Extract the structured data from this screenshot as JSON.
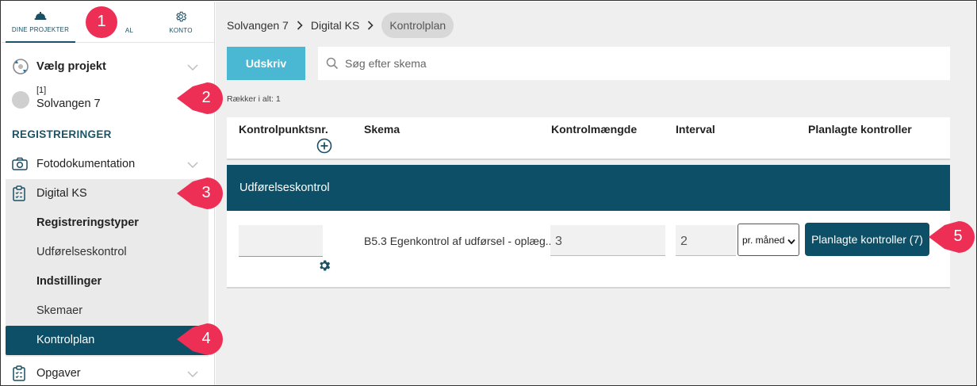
{
  "topnav": {
    "projects_label": "DINE PROJEKTER",
    "middle_label": "AL",
    "account_label": "KONTO"
  },
  "sidebar": {
    "choose_project": "Vælg projekt",
    "project": {
      "number": "[1]",
      "name": "Solvangen 7"
    },
    "section_title": "REGISTRERINGER",
    "items": [
      {
        "label": "Fotodokumentation",
        "icon": "camera-icon"
      },
      {
        "label": "Digital KS",
        "icon": "clipboard-icon"
      }
    ],
    "digital_ks_sub": [
      {
        "label": "Registreringstyper",
        "bold": true
      },
      {
        "label": "Udførelseskontrol",
        "bold": false
      },
      {
        "label": "Indstillinger",
        "bold": true
      },
      {
        "label": "Skemaer",
        "bold": false
      },
      {
        "label": "Kontrolplan",
        "active": true
      }
    ],
    "last_item": {
      "label": "Opgaver",
      "icon": "clipboard-icon"
    }
  },
  "breadcrumb": [
    "Solvangen 7",
    "Digital KS",
    "Kontrolplan"
  ],
  "toolbar": {
    "print_label": "Udskriv",
    "search_placeholder": "Søg efter skema"
  },
  "row_count": "Rækker i alt: 1",
  "table": {
    "columns": [
      "Kontrolpunktsnr.",
      "Skema",
      "Kontrolmængde",
      "Interval",
      "Planlagte kontroller"
    ],
    "group_title": "Udførelseskontrol",
    "rows": [
      {
        "kontrolpunkt": "",
        "skema": "B5.3 Egenkontrol af udførsel - oplæg...",
        "kontrolmaengde": "3",
        "interval": "2",
        "interval_unit": "pr. måned",
        "planned_button": "Planlagte kontroller (7)"
      }
    ]
  },
  "callouts": [
    "1",
    "2",
    "3",
    "4",
    "5"
  ],
  "colors": {
    "accent_dark": "#0d4f66",
    "accent_light": "#4ab8d2",
    "callout": "#ee2f55"
  }
}
